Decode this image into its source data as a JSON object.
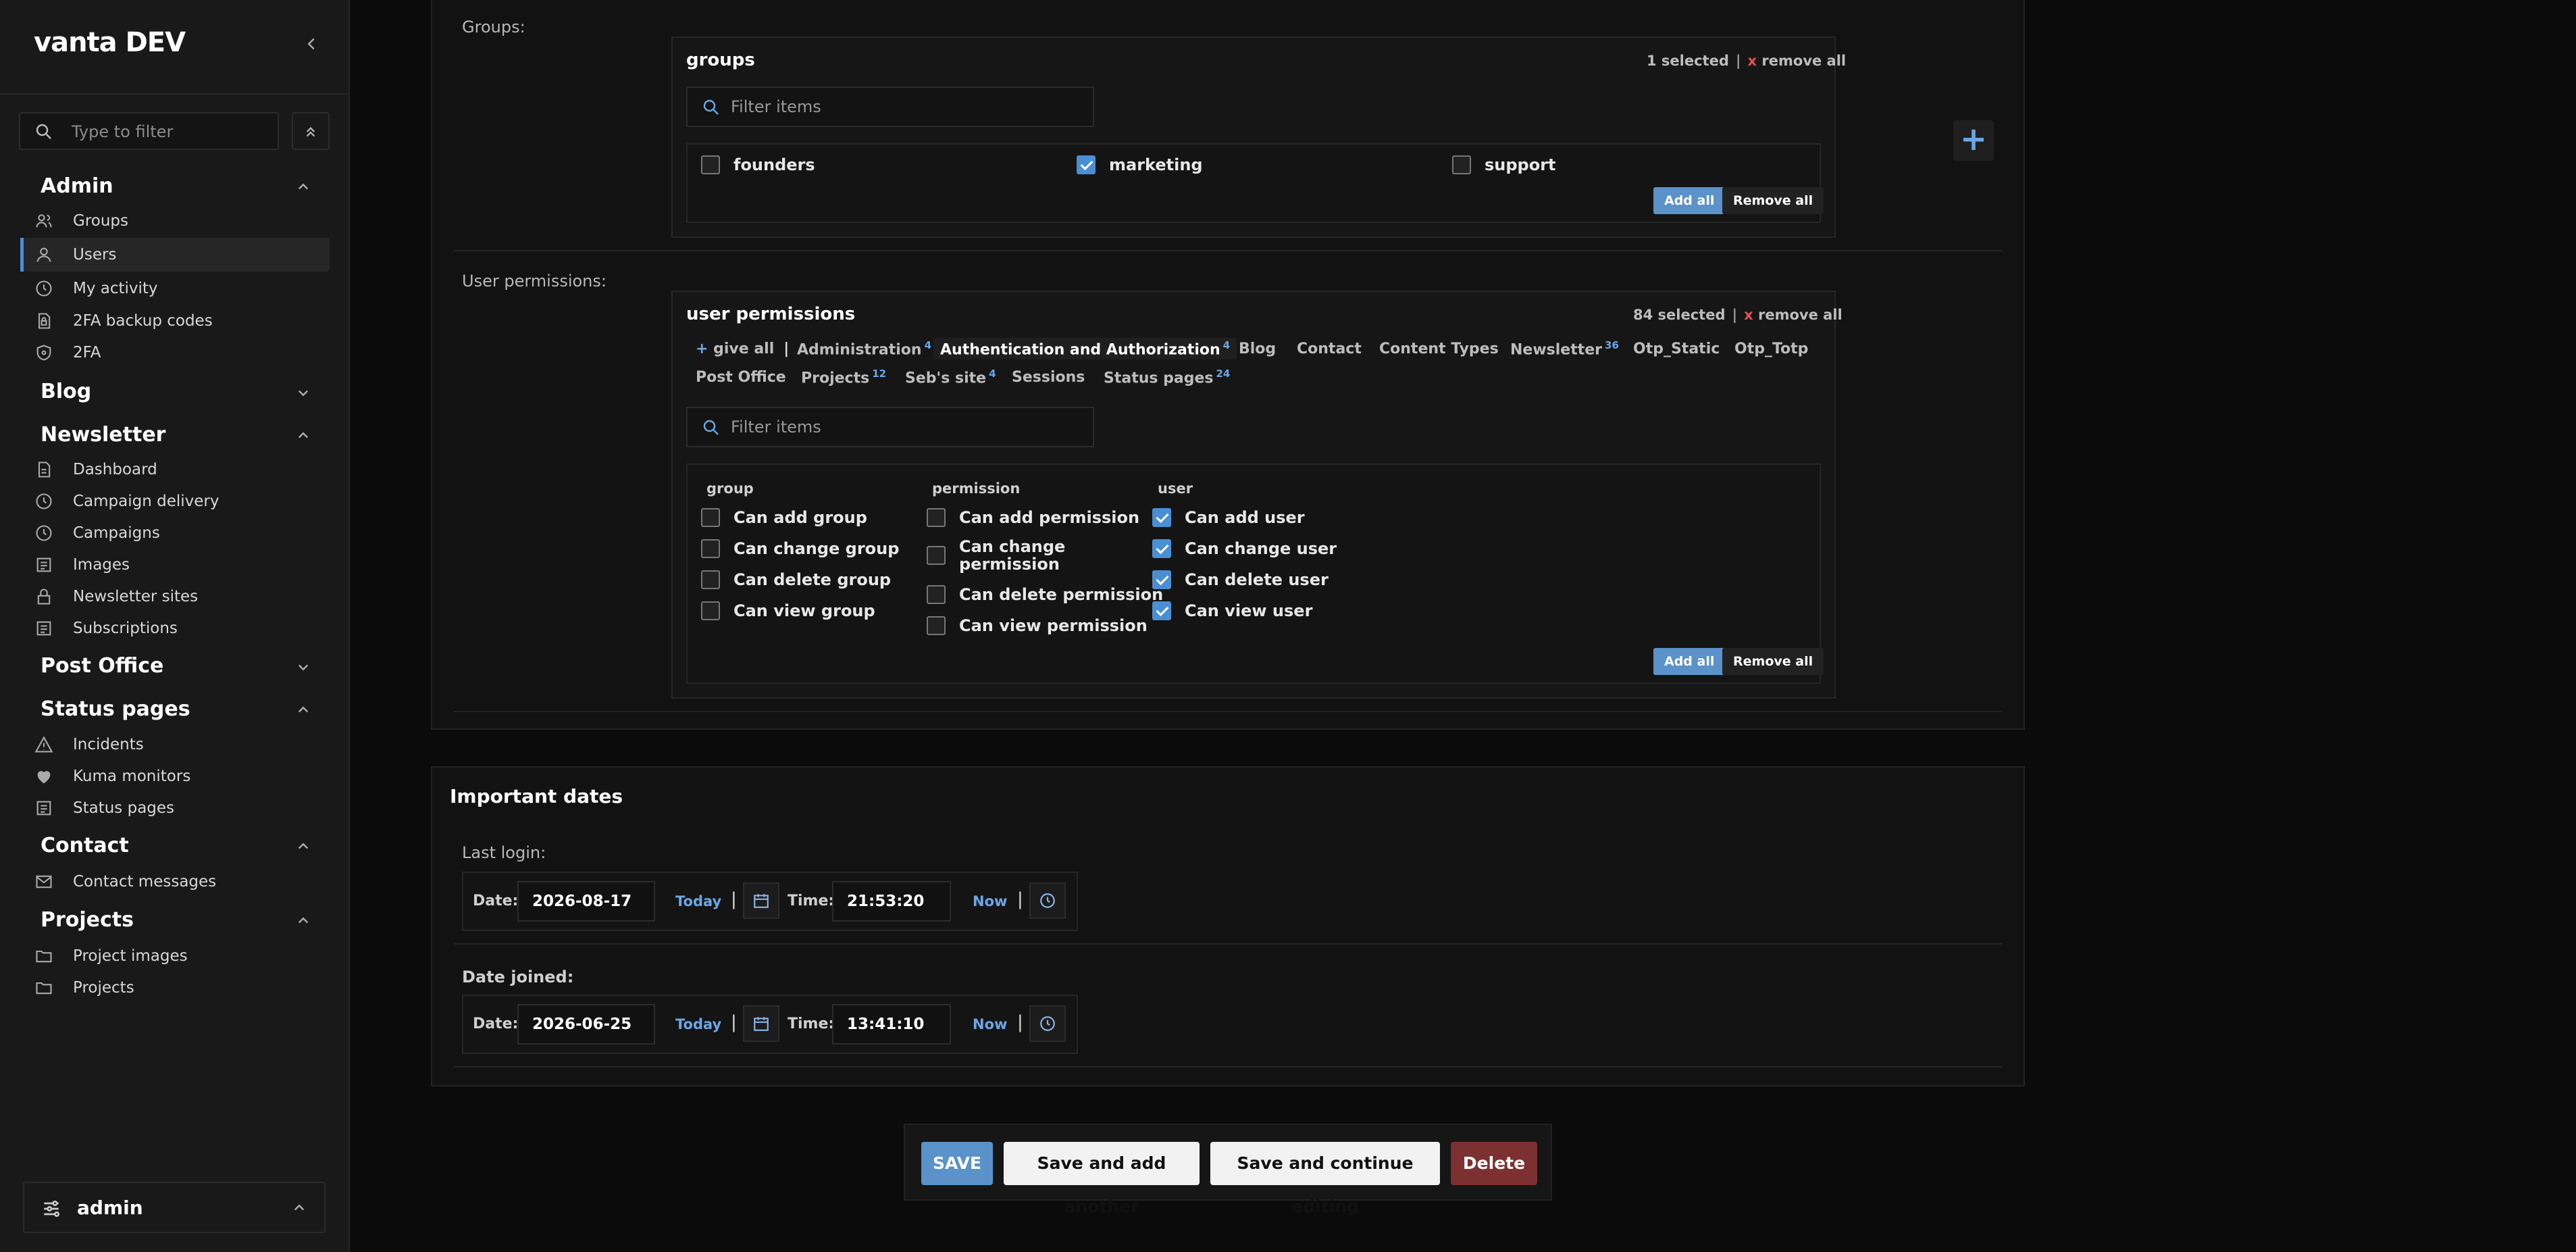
{
  "sidebar": {
    "brand": "vanta DEV",
    "filter_placeholder": "Type to filter",
    "sections": {
      "admin": {
        "title": "Admin",
        "items": [
          "Groups",
          "Users",
          "My activity",
          "2FA backup codes",
          "2FA"
        ]
      },
      "blog": {
        "title": "Blog"
      },
      "newsletter": {
        "title": "Newsletter",
        "items": [
          "Dashboard",
          "Campaign delivery",
          "Campaigns",
          "Images",
          "Newsletter sites",
          "Subscriptions"
        ]
      },
      "post_office": {
        "title": "Post Office"
      },
      "status_pages": {
        "title": "Status pages",
        "items": [
          "Incidents",
          "Kuma monitors",
          "Status pages"
        ]
      },
      "contact": {
        "title": "Contact",
        "items": [
          "Contact messages"
        ]
      },
      "projects": {
        "title": "Projects",
        "items": [
          "Project images",
          "Projects"
        ]
      }
    },
    "user": "admin"
  },
  "groups": {
    "field_label": "Groups:",
    "title": "groups",
    "selected": "1 selected",
    "remove_all_link": "remove all",
    "x": "x",
    "filter_placeholder": "Filter items",
    "options": [
      {
        "label": "founders",
        "checked": false
      },
      {
        "label": "marketing",
        "checked": true
      },
      {
        "label": "support",
        "checked": false
      }
    ],
    "add_all": "Add all",
    "remove_all": "Remove all"
  },
  "permissions": {
    "field_label": "User permissions:",
    "title": "user permissions",
    "selected": "84 selected",
    "remove_all_link": "remove all",
    "x": "x",
    "give_all": "give all",
    "tabs": [
      {
        "label": "Administration",
        "count": "4"
      },
      {
        "label": "Authentication and Authorization",
        "count": "4"
      },
      {
        "label": "Blog",
        "count": ""
      },
      {
        "label": "Contact",
        "count": ""
      },
      {
        "label": "Content Types",
        "count": ""
      },
      {
        "label": "Newsletter",
        "count": "36"
      },
      {
        "label": "Otp_Static",
        "count": ""
      },
      {
        "label": "Otp_Totp",
        "count": ""
      },
      {
        "label": "Post Office",
        "count": ""
      },
      {
        "label": "Projects",
        "count": "12"
      },
      {
        "label": "Seb's site",
        "count": "4"
      },
      {
        "label": "Sessions",
        "count": ""
      },
      {
        "label": "Status pages",
        "count": "24"
      }
    ],
    "filter_placeholder": "Filter items",
    "columns": {
      "group": {
        "title": "group",
        "items": [
          "Can add group",
          "Can change group",
          "Can delete group",
          "Can view group"
        ]
      },
      "permission": {
        "title": "permission",
        "items": [
          "Can add permission",
          "Can change permission",
          "Can delete permission",
          "Can view permission"
        ]
      },
      "user": {
        "title": "user",
        "items": [
          "Can add user",
          "Can change user",
          "Can delete user",
          "Can view user"
        ]
      }
    },
    "add_all": "Add all",
    "remove_all": "Remove all"
  },
  "dates": {
    "section_title": "Important dates",
    "last_login": {
      "label": "Last login:",
      "date": "2026-08-17",
      "time": "21:53:20"
    },
    "date_joined": {
      "label": "Date joined:",
      "date": "2026-06-25",
      "time": "13:41:10"
    },
    "date_label": "Date:",
    "time_label": "Time:",
    "today": "Today",
    "now": "Now",
    "pipe": "|"
  },
  "actions": {
    "save": "SAVE",
    "save_add": "Save and add another",
    "save_continue": "Save and continue editing",
    "delete": "Delete"
  },
  "colors": {
    "accent": "#5a92c9",
    "delete": "#7d3030",
    "danger_x": "#e05252"
  }
}
